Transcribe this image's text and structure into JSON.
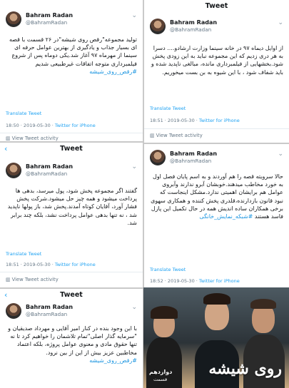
{
  "panels": [
    {
      "header": "",
      "user": {
        "name": "Bahram Radan",
        "handle": "@BahramRadan"
      },
      "text": "تولید مجموعه\"رقص روی شیشه\"در ۲۶ قسمت با قصه ای بسیار جذاب و یادگیری از بهترین عوامل حرفه ای سینما از مهرماه ۹۷ آغاز شد.یکی دوماه پس از شروع فیلمبرداری متوجه اتفاقات غیرطبیعی شدیم",
      "hashtag": "#رقص_روی_شیشه",
      "translate": "Translate Tweet",
      "time": "18:50 · 2019-05-30 · ",
      "source": "Twitter for iPhone",
      "activity": "View Tweet activity"
    },
    {
      "header": "Tweet",
      "user": {
        "name": "Bahram Radan",
        "handle": "@BahramRadan"
      },
      "text": "از اوایل دیماه ۹۷ در خانه سینما وزارت ارشادو.... دسرا به هر دری زدیم که این مجموعه نباید به این زودی پخش شود.بخشهایی از فیلمبرداری مانده، مبالغی ناپدید شده و باید شفاف شود ، با این شیوه به بن بست میخوریم.",
      "hashtag": "",
      "translate": "Translate Tweet",
      "time": "18:51 · 2019-05-30 · ",
      "source": "Twitter for iPhone",
      "activity": "View Tweet activity"
    },
    {
      "header": "Tweet",
      "user": {
        "name": "Bahram Radan",
        "handle": "@BahramRadan"
      },
      "text": "گفتند اگر مجموعه پخش شود، پول میرسد، بدهی ها پرداخت میشود و همه چیز حل میشود.شرکت پخش فشار آورد، آقایان کوتاه آمدند.پخش شد، باز پولها ناپدید شد ، نه تنها بدهی عوامل پرداخت نشد، بلکه چند برابر شد.",
      "hashtag": "",
      "translate": "Translate Tweet",
      "time": "18:51 · 2019-05-30 · ",
      "source": "Twitter for iPhone",
      "activity": "View Tweet activity"
    },
    {
      "header": "Tweet",
      "user": {
        "name": "Bahram Radan",
        "handle": "@BahramRadan"
      },
      "text": "حالا سرویته قصه را هم آوردند و به اسم پایان فصل اول به خورد مخاطب میدهند.خوبشان آبرو ندارند وآبروی عوامل هم برایشان اهمیتی ندارد.مشکل اینجاست که نبود قانون بازدارنده،قلدری پخش کننده و همکاری سهوی برخی همکاران ساده اندیش همه در حال تکمیل این پازل فاسد هستند",
      "hashtag": "#شبکه_نمایش_خانگی",
      "translate": "Translate Tweet",
      "time": "18:52 · 2019-05-30 · ",
      "source": "Twitter for iPhone",
      "activity": ""
    },
    {
      "header": "Tweet",
      "user": {
        "name": "Bahram Radan",
        "handle": "@BahramRadan"
      },
      "text": "با این وجود بنده در کنار امیر آقایی و مهرداد صدیقیان و \"سرمایه گذار اصلی\"تمام تلاشمان را خواهیم کرد تا نه تنها حقوق مادی و معنوی عوامل پروژه، بلکه اعتماد مخاطبین عزیز بیش از این از بین نرود.",
      "hashtag": "#رقص_روی_شیشه",
      "translate": "",
      "time": "",
      "source": "",
      "activity": ""
    }
  ],
  "poster": {
    "title_art": "روی شیشه",
    "episode_label": "دوازدهم",
    "episode_sub": "قسمت"
  },
  "colors": {
    "link": "#1da1f2",
    "hashtag": "#1b95e0",
    "muted": "#657786"
  }
}
